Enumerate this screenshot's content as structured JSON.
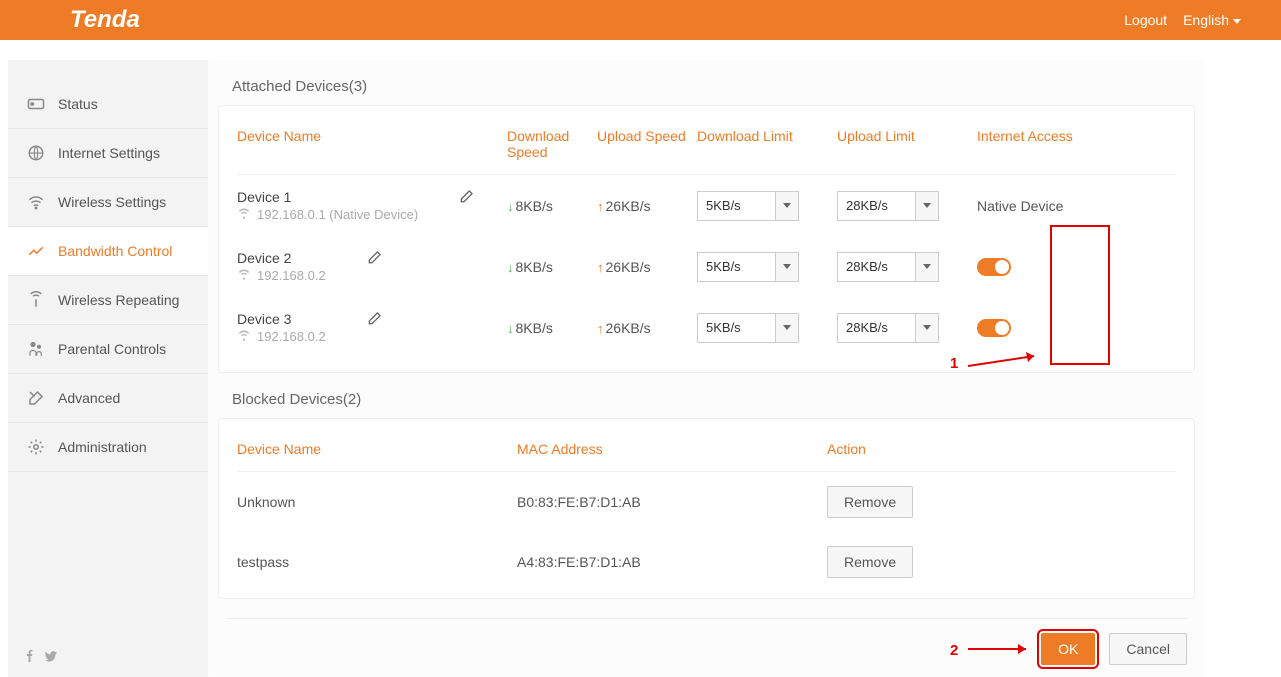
{
  "header": {
    "logout": "Logout",
    "language": "English"
  },
  "sidebar": {
    "items": [
      {
        "label": "Status"
      },
      {
        "label": "Internet Settings"
      },
      {
        "label": "Wireless Settings"
      },
      {
        "label": "Bandwidth Control"
      },
      {
        "label": "Wireless Repeating"
      },
      {
        "label": "Parental Controls"
      },
      {
        "label": "Advanced"
      },
      {
        "label": "Administration"
      }
    ]
  },
  "attached": {
    "title": "Attached Devices(3)",
    "headers": {
      "name": "Device Name",
      "dl_speed": "Download Speed",
      "ul_speed": "Upload Speed",
      "dl_limit": "Download Limit",
      "ul_limit": "Upload Limit",
      "access": "Internet Access"
    },
    "devices": [
      {
        "name": "Device 1",
        "ip": "192.168.0.1 (Native Device)",
        "dl": "8KB/s",
        "ul": "26KB/s",
        "dl_limit": "5KB/s",
        "ul_limit": "28KB/s",
        "access": "Native Device"
      },
      {
        "name": "Device 2",
        "ip": "192.168.0.2",
        "dl": "8KB/s",
        "ul": "26KB/s",
        "dl_limit": "5KB/s",
        "ul_limit": "28KB/s",
        "access_toggle": true
      },
      {
        "name": "Device 3",
        "ip": "192.168.0.2",
        "dl": "8KB/s",
        "ul": "26KB/s",
        "dl_limit": "5KB/s",
        "ul_limit": "28KB/s",
        "access_toggle": true
      }
    ]
  },
  "blocked": {
    "title": "Blocked Devices(2)",
    "headers": {
      "name": "Device Name",
      "mac": "MAC Address",
      "action": "Action"
    },
    "devices": [
      {
        "name": "Unknown",
        "mac": "B0:83:FE:B7:D1:AB",
        "btn": "Remove"
      },
      {
        "name": "testpass",
        "mac": "A4:83:FE:B7:D1:AB",
        "btn": "Remove"
      }
    ]
  },
  "footer": {
    "ok": "OK",
    "cancel": "Cancel"
  },
  "annotations": {
    "one": "1",
    "two": "2"
  }
}
